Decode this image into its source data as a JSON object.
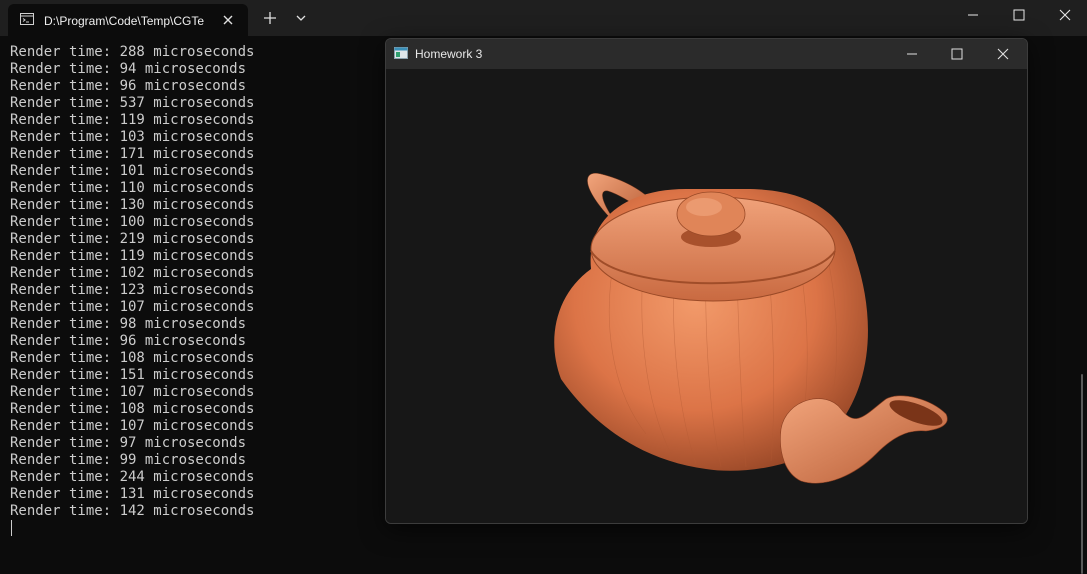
{
  "terminal": {
    "tab_title": "D:\\Program\\Code\\Temp\\CGTe",
    "lines": [
      "Render time: 288 microseconds",
      "Render time: 94 microseconds",
      "Render time: 96 microseconds",
      "Render time: 537 microseconds",
      "Render time: 119 microseconds",
      "Render time: 103 microseconds",
      "Render time: 171 microseconds",
      "Render time: 101 microseconds",
      "Render time: 110 microseconds",
      "Render time: 130 microseconds",
      "Render time: 100 microseconds",
      "Render time: 219 microseconds",
      "Render time: 119 microseconds",
      "Render time: 102 microseconds",
      "Render time: 123 microseconds",
      "Render time: 107 microseconds",
      "Render time: 98 microseconds",
      "Render time: 96 microseconds",
      "Render time: 108 microseconds",
      "Render time: 151 microseconds",
      "Render time: 107 microseconds",
      "Render time: 108 microseconds",
      "Render time: 107 microseconds",
      "Render time: 97 microseconds",
      "Render time: 99 microseconds",
      "Render time: 244 microseconds",
      "Render time: 131 microseconds",
      "Render time: 142 microseconds"
    ]
  },
  "gl_window": {
    "title": "Homework 3",
    "scene": "teapot",
    "teapot_color": "#e07a4c",
    "background_color": "#171717"
  },
  "icons": {
    "terminal_tab": "terminal-icon",
    "new_tab": "plus-icon",
    "dropdown": "chevron-down-icon",
    "minimize": "minimize-icon",
    "maximize": "maximize-icon",
    "close": "close-icon"
  }
}
